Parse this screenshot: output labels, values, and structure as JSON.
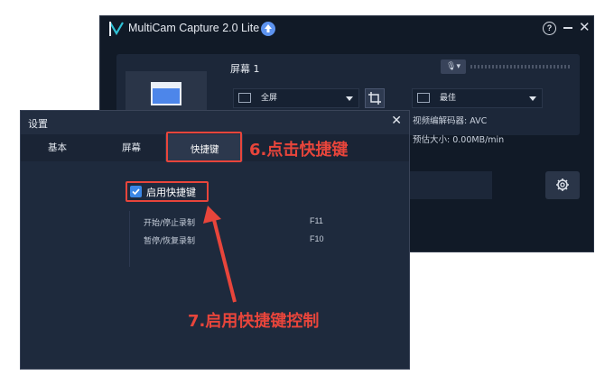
{
  "main_window": {
    "title": "MultiCam Capture 2.0 Lite",
    "help_icon": "?",
    "screen_label": "屏幕 1",
    "capture_mode": "全屏",
    "quality": "最佳",
    "encoder_text": "视频编解码器: AVC",
    "size_text": "预估大小: 0.00MB/min"
  },
  "settings": {
    "title": "设置",
    "tabs": [
      "基本",
      "屏幕",
      "快捷键"
    ],
    "enable_hotkeys_label": "启用快捷键",
    "hotkeys": [
      {
        "name": "开始/停止录制",
        "key": "F11"
      },
      {
        "name": "暂停/恢复录制",
        "key": "F10"
      }
    ]
  },
  "annotations": {
    "step6": "6.点击快捷键",
    "step7": "7.启用快捷键控制",
    "color": "#e8453b"
  },
  "icons": [
    "logo-icon",
    "upload-icon",
    "help-icon",
    "minimize-icon",
    "close-icon",
    "monitor-icon",
    "microphone-icon",
    "crop-icon",
    "gear-icon",
    "check-icon"
  ]
}
